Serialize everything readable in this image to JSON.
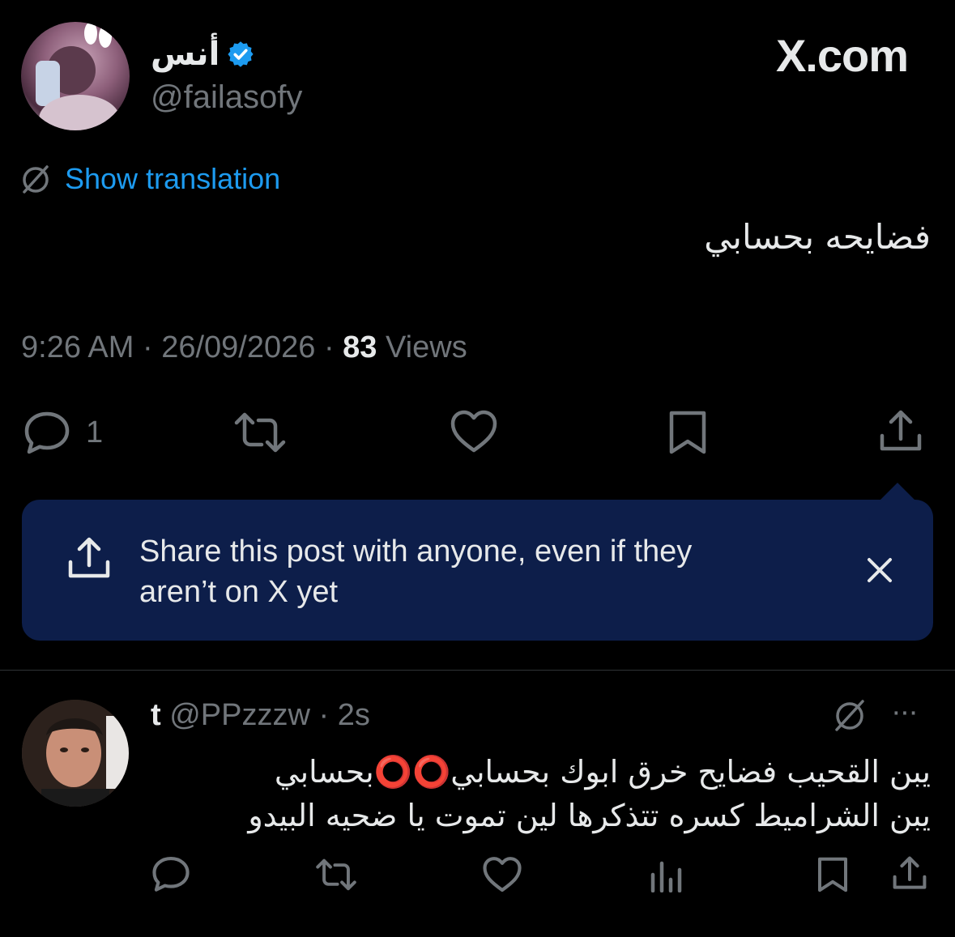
{
  "post": {
    "display_name": "أنس",
    "handle": "@failasofy",
    "brand": "X.com",
    "translate_label": "Show translation",
    "text": "فضايحه بحسابي",
    "time": "9:26 AM",
    "date": "26/09/2026",
    "views_count": "83",
    "views_label": "Views",
    "reply_count": "1"
  },
  "tooltip": {
    "line1": "Share this post with anyone, even if they",
    "line2": "aren’t on X yet"
  },
  "reply": {
    "name": "t",
    "handle": "@PPzzzw",
    "age": "2s",
    "more": "···",
    "line1": "يبن القحيب  فضايح خرق ابوك بحسابي⭕️⭕️بحسابي",
    "line2": "يبن الشراميط كسره تتذكرها لين تموت يا ضحيه البيدو"
  },
  "colors": {
    "background": "#000000",
    "accent": "#1d9bf0",
    "muted": "#71767b",
    "tooltip_bg": "#0d1e4a"
  }
}
